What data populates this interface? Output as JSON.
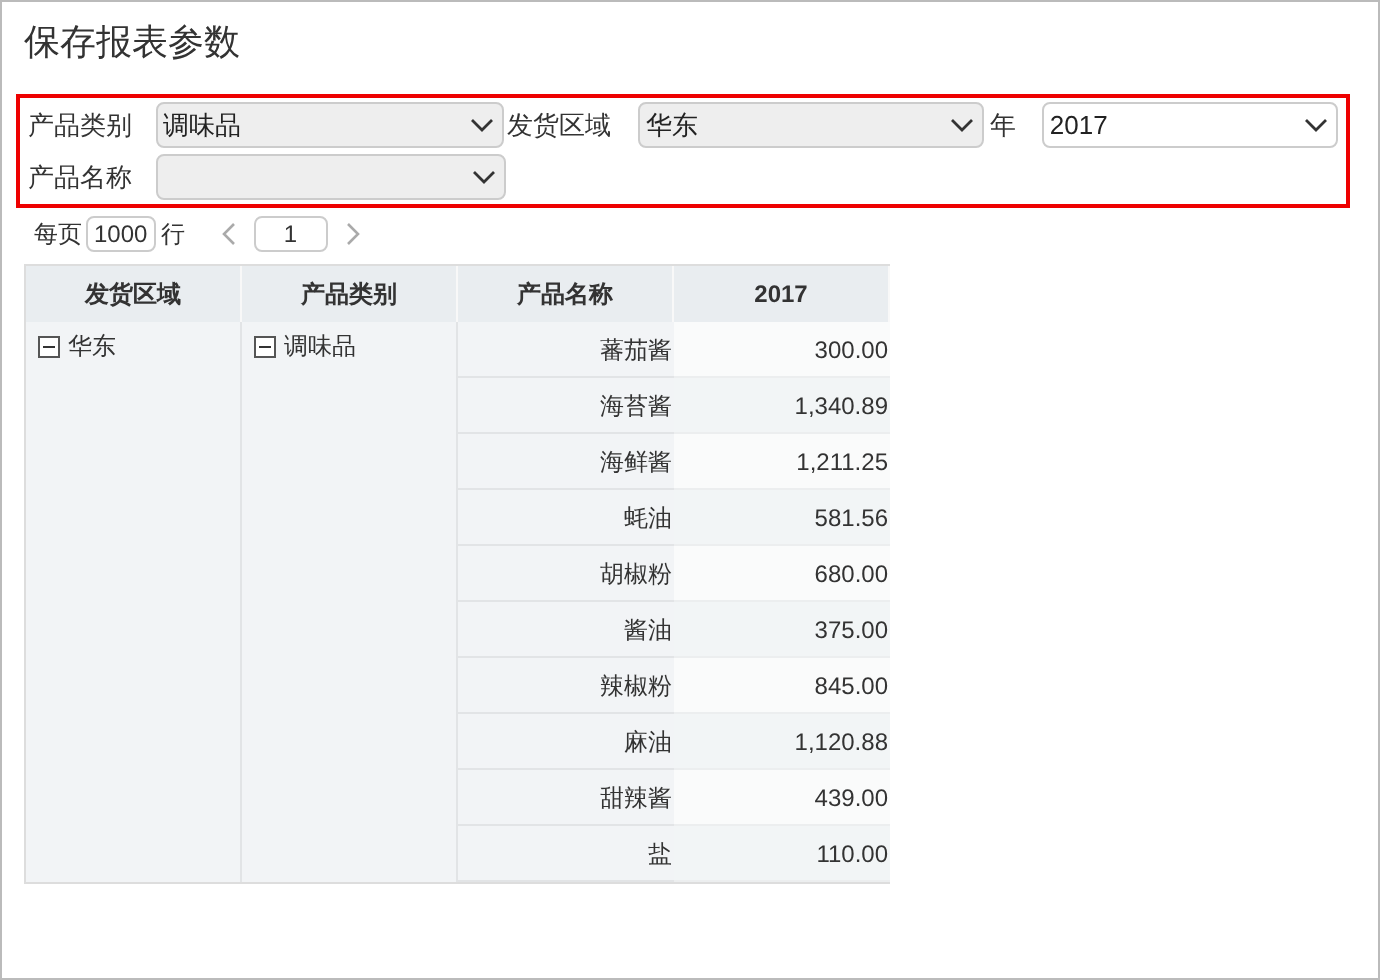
{
  "title": "保存报表参数",
  "params": [
    {
      "label": "产品类别",
      "value": "调味品",
      "filled": true
    },
    {
      "label": "发货区域",
      "value": "华东",
      "filled": true
    },
    {
      "label": "年",
      "value": "2017",
      "filled": false
    },
    {
      "label": "产品名称",
      "filled": true
    }
  ],
  "pager": {
    "per_page_label": "每页",
    "per_page": "1000",
    "rows_label": "行",
    "page": "1"
  },
  "table": {
    "columns": [
      "发货区域",
      "产品类别",
      "产品名称",
      "2017"
    ],
    "region": {
      "label": "华东",
      "expanded": true
    },
    "category": {
      "label": "调味品",
      "expanded": true
    },
    "rows": [
      {
        "name": "蕃茄酱",
        "value": "300.00"
      },
      {
        "name": "海苔酱",
        "value": "1,340.89"
      },
      {
        "name": "海鲜酱",
        "value": "1,211.25"
      },
      {
        "name": "蚝油",
        "value": "581.56"
      },
      {
        "name": "胡椒粉",
        "value": "680.00"
      },
      {
        "name": "酱油",
        "value": "375.00"
      },
      {
        "name": "辣椒粉",
        "value": "845.00"
      },
      {
        "name": "麻油",
        "value": "1,120.88"
      },
      {
        "name": "甜辣酱",
        "value": "439.00"
      },
      {
        "name": "盐",
        "value": "110.00"
      }
    ]
  }
}
